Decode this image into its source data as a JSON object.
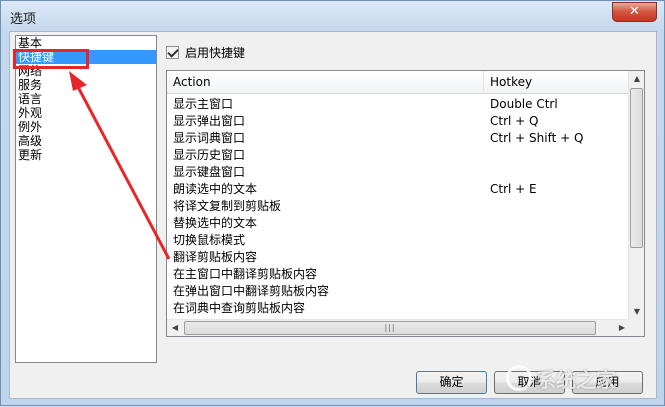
{
  "window": {
    "title": "选项",
    "close_label": "✕"
  },
  "sidebar": {
    "items": [
      {
        "label": "基本",
        "selected": false
      },
      {
        "label": "快捷键",
        "selected": true
      },
      {
        "label": "网络",
        "selected": false
      },
      {
        "label": "服务",
        "selected": false
      },
      {
        "label": "语言",
        "selected": false
      },
      {
        "label": "外观",
        "selected": false
      },
      {
        "label": "例外",
        "selected": false
      },
      {
        "label": "高级",
        "selected": false
      },
      {
        "label": "更新",
        "selected": false
      }
    ]
  },
  "hotkeys": {
    "enable_label": "启用快捷键",
    "enabled": true,
    "columns": {
      "action": "Action",
      "hotkey": "Hotkey"
    },
    "rows": [
      {
        "action": "显示主窗口",
        "hotkey": "Double Ctrl"
      },
      {
        "action": "显示弹出窗口",
        "hotkey": "Ctrl + Q"
      },
      {
        "action": "显示词典窗口",
        "hotkey": "Ctrl + Shift + Q"
      },
      {
        "action": "显示历史窗口",
        "hotkey": ""
      },
      {
        "action": "显示键盘窗口",
        "hotkey": ""
      },
      {
        "action": "朗读选中的文本",
        "hotkey": "Ctrl + E"
      },
      {
        "action": "将译文复制到剪贴板",
        "hotkey": ""
      },
      {
        "action": "替换选中的文本",
        "hotkey": ""
      },
      {
        "action": "切换鼠标模式",
        "hotkey": ""
      },
      {
        "action": "翻译剪贴板内容",
        "hotkey": ""
      },
      {
        "action": "在主窗口中翻译剪贴板内容",
        "hotkey": ""
      },
      {
        "action": "在弹出窗口中翻译剪贴板内容",
        "hotkey": ""
      },
      {
        "action": "在词典中查询剪贴板内容",
        "hotkey": ""
      }
    ]
  },
  "buttons": {
    "ok": "确定",
    "cancel": "取消",
    "apply": "应用"
  },
  "annotation": {
    "color": "#e8262a"
  },
  "watermark": {
    "text": "系统之家"
  }
}
